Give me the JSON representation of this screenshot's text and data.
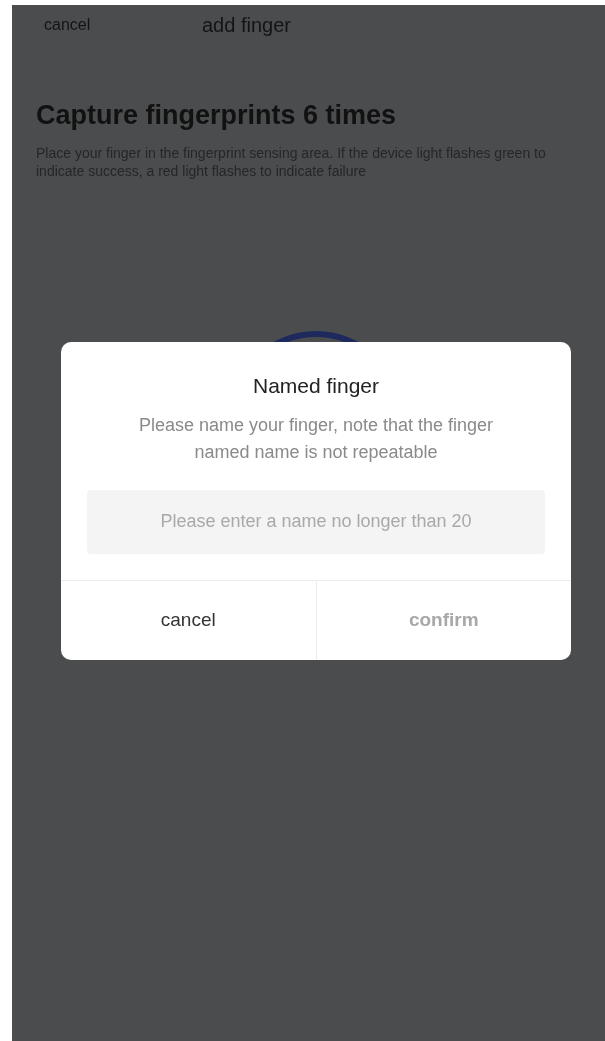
{
  "nav_bar": {
    "left_action": "cancel",
    "title": "add finger"
  },
  "heading": "Capture fingerprints 6 times",
  "instructions": "Place your finger in the fingerprint sensing area. If the device light flashes green to indicate success, a red light flashes to indicate failure",
  "dialog": {
    "title": "Named finger",
    "message": "Please name your finger, note that the finger named name is not repeatable",
    "input": {
      "placeholder": "Please enter a name no longer than 20"
    },
    "buttons": [
      {
        "label": "cancel",
        "disabled": false
      },
      {
        "label": "confirm",
        "disabled": true
      }
    ]
  }
}
